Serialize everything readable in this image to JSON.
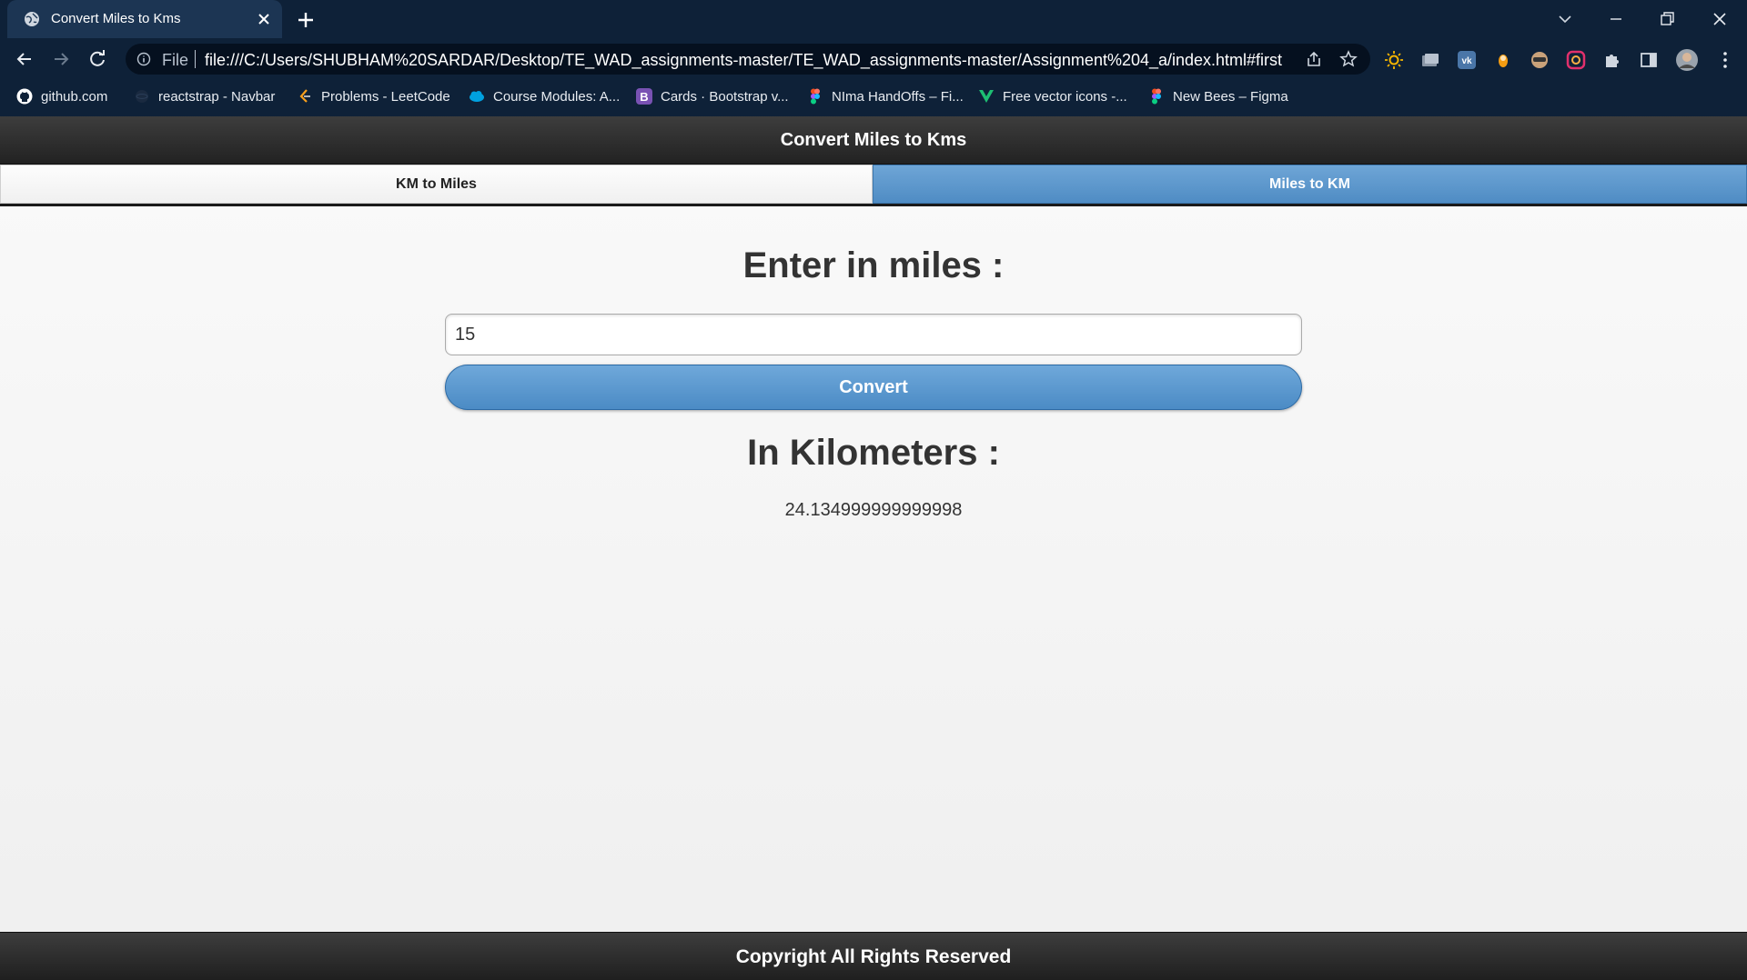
{
  "browser": {
    "tab_title": "Convert Miles to Kms",
    "url_scheme": "File",
    "url": "file:///C:/Users/SHUBHAM%20SARDAR/Desktop/TE_WAD_assignments-master/TE_WAD_assignments-master/Assignment%204_a/index.html#first",
    "bookmarks": [
      {
        "label": "github.com",
        "icon": "github-icon"
      },
      {
        "label": "reactstrap - Navbar",
        "icon": "reactstrap-icon"
      },
      {
        "label": "Problems - LeetCode",
        "icon": "leetcode-icon"
      },
      {
        "label": "Course Modules: A...",
        "icon": "salesforce-icon"
      },
      {
        "label": "Cards · Bootstrap v...",
        "icon": "bootstrap-icon"
      },
      {
        "label": "NIma HandOffs – Fi...",
        "icon": "figma-icon"
      },
      {
        "label": "Free vector icons -...",
        "icon": "vector-icon"
      },
      {
        "label": "New Bees – Figma",
        "icon": "figma-icon"
      }
    ],
    "colors": {
      "chrome": "#0e2138",
      "tab": "#1c3553",
      "omnibox": "#05101f"
    }
  },
  "page": {
    "header_title": "Convert Miles to Kms",
    "nav": {
      "km_to_miles": "KM to Miles",
      "miles_to_km": "Miles to KM"
    },
    "active_tab": "Miles to KM",
    "input_heading": "Enter in miles :",
    "input_value": "15",
    "convert_label": "Convert",
    "result_heading": "In Kilometers :",
    "result_value": "24.134999999999998",
    "footer": "Copyright All Rights Reserved",
    "colors": {
      "accent": "#5b97cd",
      "header": "#2d2d2d"
    }
  }
}
